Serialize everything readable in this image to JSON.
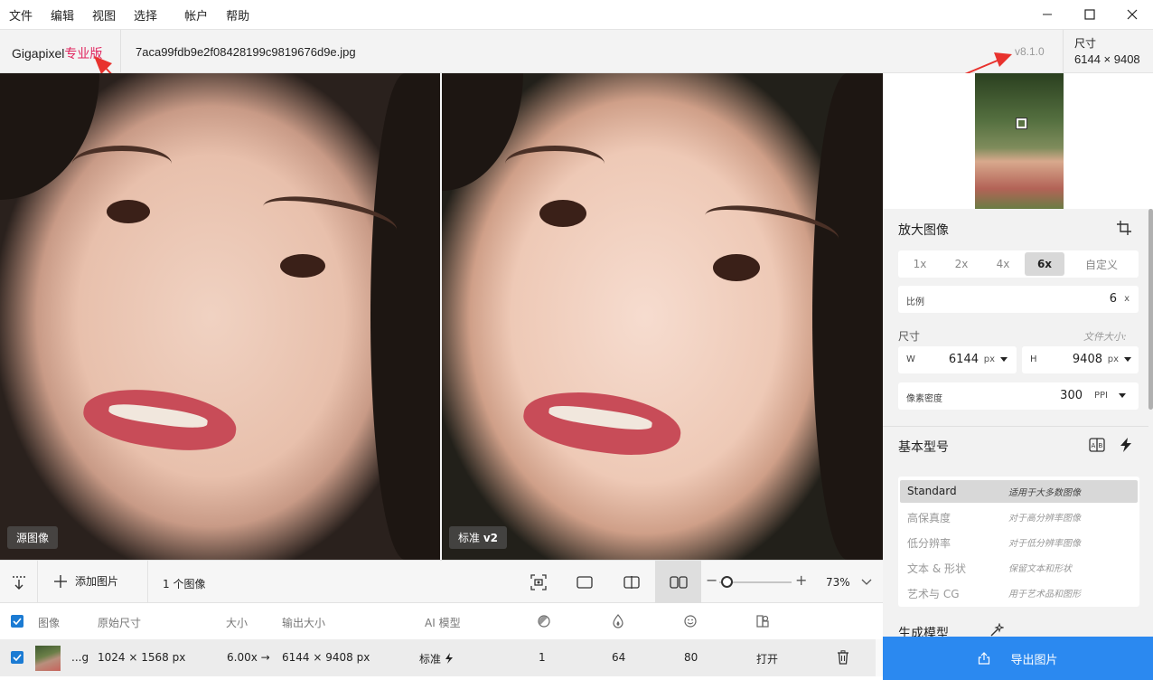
{
  "menu": [
    "文件",
    "编辑",
    "视图",
    "选择",
    "帐户",
    "帮助"
  ],
  "header": {
    "brand": "Gigapixel",
    "edition": "专业版",
    "filename": "7aca99fdb9e2f08428199c9819676d9e.jpg",
    "version": "v8.1.0",
    "dims_label": "尺寸",
    "dims_value": "6144 × 9408"
  },
  "viewer": {
    "left_tag": "源图像",
    "right_tag_text": "标准",
    "right_tag_bold": "v2"
  },
  "toolbar": {
    "add_label": "添加图片",
    "count_label": "1 个图像",
    "zoom": "73%",
    "zoom_fraction": 0.1
  },
  "table": {
    "headers": {
      "image": "图像",
      "orig_size": "原始尺寸",
      "scale": "大小",
      "out_size": "输出大小",
      "model": "AI 模型"
    },
    "row": {
      "name": "...g",
      "orig_size": "1024 × 1568 px",
      "scale": "6.00x →",
      "out_size": "6144 × 9408 px",
      "model": "标准",
      "v1": "1",
      "v2": "64",
      "v3": "80",
      "action": "打开"
    }
  },
  "panel": {
    "upscale_title": "放大图像",
    "scales": [
      "1x",
      "2x",
      "4x",
      "6x",
      "自定义"
    ],
    "active_scale": "6x",
    "ratio_label": "比例",
    "ratio_value": "6",
    "ratio_unit": "x",
    "size_label": "尺寸",
    "filesize_label": "文件大小:",
    "w_label": "W",
    "w_value": "6144",
    "w_unit": "px",
    "h_label": "H",
    "h_value": "9408",
    "h_unit": "px",
    "density_label": "像素密度",
    "density_value": "300",
    "density_unit": "PPI",
    "base_model_title": "基本型号",
    "models": [
      {
        "name": "Standard",
        "desc": "适用于大多数图像"
      },
      {
        "name": "高保真度",
        "desc": "对于高分辨率图像"
      },
      {
        "name": "低分辨率",
        "desc": "对于低分辨率图像"
      },
      {
        "name": "文本 & 形状",
        "desc": "保留文本和形状"
      },
      {
        "name": "艺术与 CG",
        "desc": "用于艺术品和图形"
      }
    ],
    "gen_model_title": "生成模型",
    "export_label": "导出图片"
  },
  "colors": {
    "accent": "#2b89f0",
    "brand_pro": "#e0245e",
    "checkbox": "#1b7bd3"
  }
}
